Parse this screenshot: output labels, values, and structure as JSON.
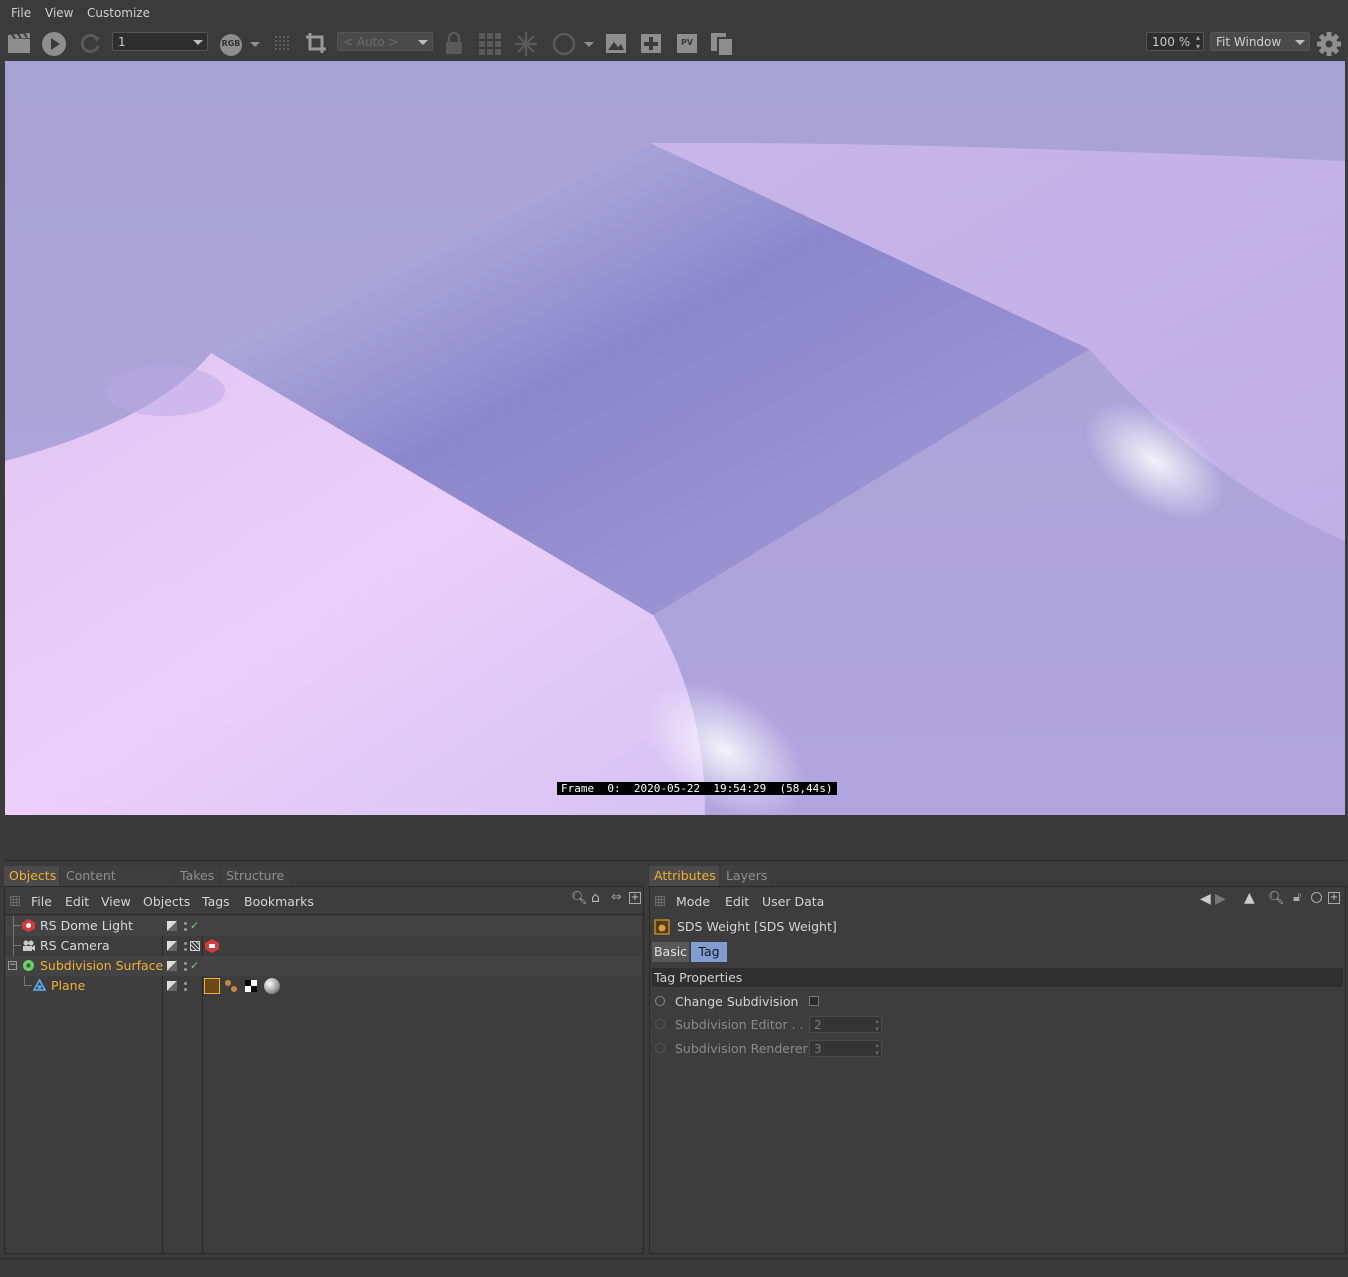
{
  "menubar": {
    "items": [
      "File",
      "View",
      "Customize"
    ]
  },
  "toolbar": {
    "frame_combo": "1",
    "rgb_badge": "RGB",
    "auto_combo": "< Auto >",
    "zoom_value": "100 %",
    "fit_combo": "Fit Window",
    "icons": [
      "clapboard-icon",
      "play-icon",
      "refresh-icon",
      "rgb-icon",
      "dots-grid-icon",
      "crop-icon",
      "lock-icon",
      "grid-icon",
      "snowflake-icon",
      "circle-icon",
      "image-icon",
      "add-image-icon",
      "pv-icon",
      "copy-icon",
      "gear-icon"
    ]
  },
  "viewport": {
    "frame_text": "Frame  0:  2020-05-22  19:54:29  (58,44s)"
  },
  "objects_panel": {
    "tabs": [
      "Objects",
      "Content Browser",
      "Takes",
      "Structure"
    ],
    "active_tab": "Objects",
    "menu": [
      "File",
      "Edit",
      "View",
      "Objects",
      "Tags",
      "Bookmarks"
    ],
    "rows": [
      {
        "name": "RS Dome Light",
        "highlight": false,
        "icon": "dome-light-icon",
        "icon_color": "#d83a3a"
      },
      {
        "name": "RS Camera",
        "highlight": false,
        "icon": "camera-icon",
        "icon_color": "#cfcfcf"
      },
      {
        "name": "Subdivision Surface",
        "highlight": true,
        "icon": "subdivision-icon",
        "icon_color": "#6bd06b"
      },
      {
        "name": "Plane",
        "highlight": true,
        "icon": "plane-icon",
        "icon_color": "#5aa8e0"
      }
    ]
  },
  "attributes_panel": {
    "tabs": [
      "Attributes",
      "Layers"
    ],
    "active_tab": "Attributes",
    "menu": [
      "Mode",
      "Edit",
      "User Data"
    ],
    "header": "SDS Weight [SDS Weight]",
    "subtabs": [
      "Basic",
      "Tag"
    ],
    "active_subtab": "Tag",
    "section": "Tag Properties",
    "fields": [
      {
        "label": "Change Subdivision",
        "value": "",
        "enabled": true
      },
      {
        "label": "Subdivision Editor . . .",
        "value": "2",
        "enabled": false
      },
      {
        "label": "Subdivision Renderer",
        "value": "3",
        "enabled": false
      }
    ]
  }
}
